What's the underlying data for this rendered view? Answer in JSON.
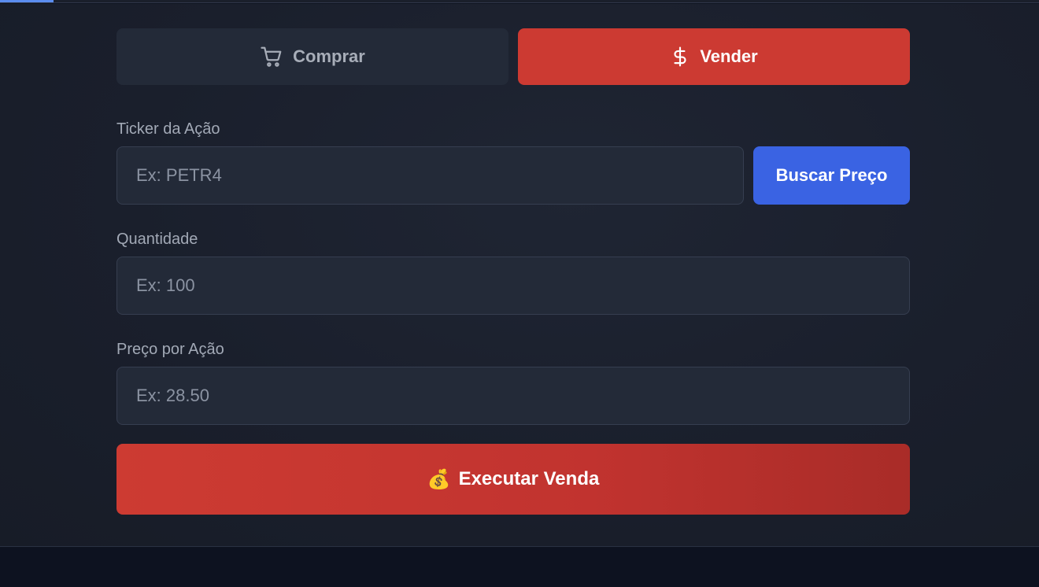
{
  "tabs": {
    "buy": {
      "label": "Comprar",
      "icon": "cart-icon"
    },
    "sell": {
      "label": "Vender",
      "icon": "dollar-icon",
      "active": true
    }
  },
  "form": {
    "ticker": {
      "label": "Ticker da Ação",
      "placeholder": "Ex: PETR4",
      "value": ""
    },
    "search_button": "Buscar Preço",
    "quantity": {
      "label": "Quantidade",
      "placeholder": "Ex: 100",
      "value": ""
    },
    "price": {
      "label": "Preço por Ação",
      "placeholder": "Ex: 28.50",
      "value": ""
    },
    "submit": {
      "emoji": "💰",
      "label": "Executar Venda",
      "icon": "money-bag-icon"
    }
  },
  "colors": {
    "sell_accent": "#cc3a32",
    "search_accent": "#3a63e3",
    "panel_bg": "#1c2230",
    "input_bg": "#232a38"
  }
}
